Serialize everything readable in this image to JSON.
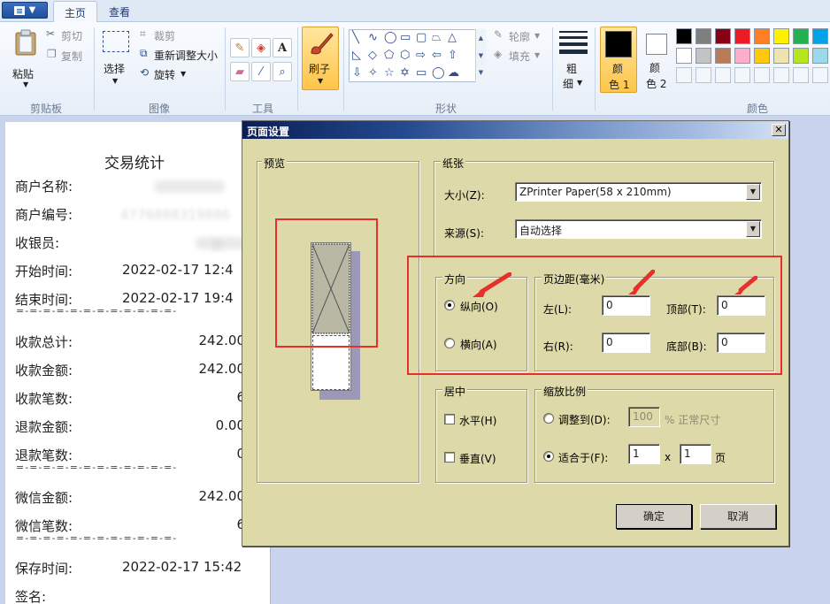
{
  "ribbon": {
    "tabs": [
      "主页",
      "查看"
    ],
    "clipboard": {
      "paste": "粘贴",
      "cut": "剪切",
      "copy": "复制",
      "group": "剪贴板"
    },
    "image": {
      "select": "选择",
      "crop": "裁剪",
      "resize": "重新调整大小",
      "rotate": "旋转",
      "group": "图像"
    },
    "tools": {
      "group": "工具",
      "text_glyph": "A"
    },
    "brush": {
      "label": "刷子"
    },
    "shapes": {
      "outline": "轮廓",
      "fill": "填充",
      "group": "形状"
    },
    "size": {
      "label1": "粗",
      "label2": "细"
    },
    "colors": {
      "color1": "颜",
      "color1b": "色 1",
      "color2": "颜",
      "color2b": "色 2",
      "group": "颜色",
      "palette_row1": [
        "#000000",
        "#7f7f7f",
        "#880015",
        "#ed1c24",
        "#ff7f27",
        "#fff200",
        "#22b14c",
        "#00a2e8"
      ],
      "palette_row2": [
        "#ffffff",
        "#c3c3c3",
        "#b97a57",
        "#ffaec9",
        "#ffc90e",
        "#efe4b0",
        "#b5e61d",
        "#99d9ea"
      ]
    }
  },
  "document": {
    "title": "交易统计",
    "rows": [
      {
        "label": "商户名称:",
        "value": ""
      },
      {
        "label": "商户编号:",
        "value": ""
      },
      {
        "label": "收银员:",
        "value": ""
      },
      {
        "label": "开始时间:",
        "value": "2022-02-17 12:4"
      },
      {
        "label": "结束时间:",
        "value": "2022-02-17 19:4"
      },
      {
        "label": "收款总计:",
        "value": "242.00"
      },
      {
        "label": "收款金额:",
        "value": "242.00"
      },
      {
        "label": "收款笔数:",
        "value": "6"
      },
      {
        "label": "退款金额:",
        "value": "0.00"
      },
      {
        "label": "退款笔数:",
        "value": "0"
      },
      {
        "label": "微信金额:",
        "value": "242.00"
      },
      {
        "label": "微信笔数:",
        "value": "6"
      },
      {
        "label": "保存时间:",
        "value": "2022-02-17 15:42"
      },
      {
        "label": "签名:",
        "value": ""
      }
    ],
    "merchant_id_partial": "4776888319886",
    "cashier_partial": "张",
    "dash": "=-=-=-=-=-=-=-=-=-=-=-=-"
  },
  "dialog": {
    "title": "页面设置",
    "close": "✕",
    "preview": "预览",
    "paper": {
      "title": "纸张",
      "size_label": "大小(Z):",
      "size_value": "ZPrinter Paper(58 x 210mm)",
      "source_label": "来源(S):",
      "source_value": "自动选择"
    },
    "orientation": {
      "title": "方向",
      "portrait": "纵向(O)",
      "landscape": "横向(A)",
      "selected": "portrait"
    },
    "margins": {
      "title": "页边距(毫米)",
      "left_label": "左(L):",
      "left": "0",
      "right_label": "右(R):",
      "right": "0",
      "top_label": "顶部(T):",
      "top": "0",
      "bottom_label": "底部(B):",
      "bottom": "0"
    },
    "center": {
      "title": "居中",
      "horizontal": "水平(H)",
      "vertical": "垂直(V)"
    },
    "scale": {
      "title": "缩放比例",
      "adjust_label": "调整到(D):",
      "adjust_value": "100",
      "adjust_unit": "% 正常尺寸",
      "fit_label": "适合于(F):",
      "fit_w": "1",
      "fit_x": "x",
      "fit_h": "1",
      "fit_unit": "页",
      "selected": "fit"
    },
    "ok": "确定",
    "cancel": "取消"
  }
}
